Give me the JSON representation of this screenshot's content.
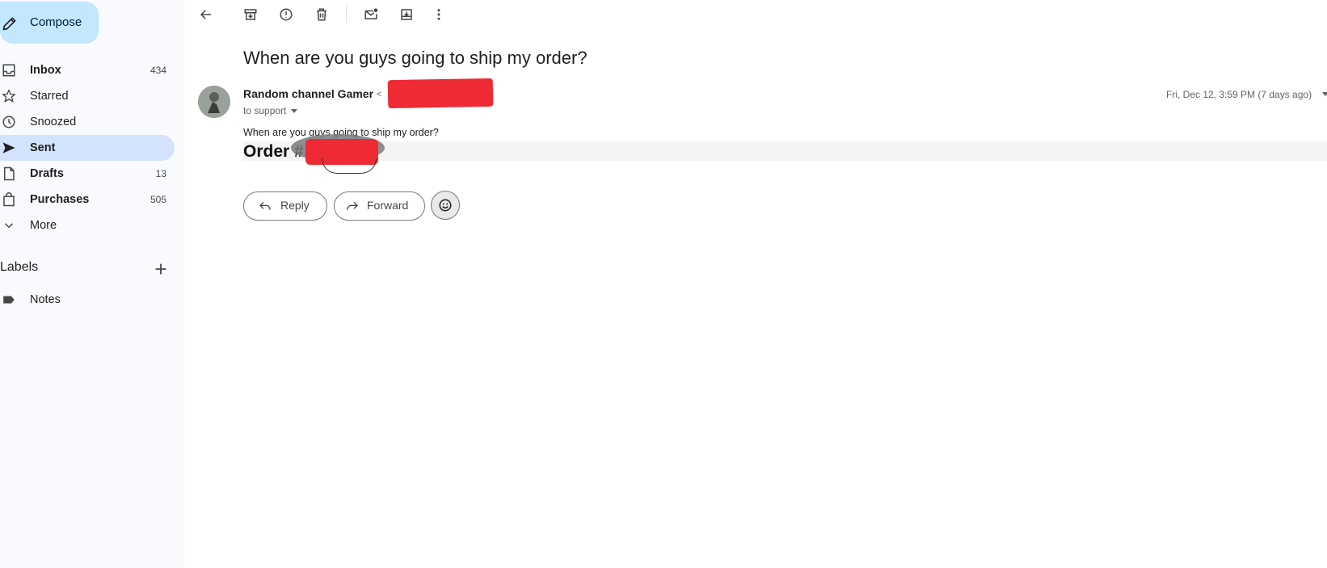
{
  "sidebar": {
    "compose_label": "Compose",
    "items": [
      {
        "label": "Inbox",
        "count": "434"
      },
      {
        "label": "Starred",
        "count": ""
      },
      {
        "label": "Snoozed",
        "count": ""
      },
      {
        "label": "Sent",
        "count": ""
      },
      {
        "label": "Drafts",
        "count": "13"
      },
      {
        "label": "Purchases",
        "count": "505"
      },
      {
        "label": "More",
        "count": ""
      }
    ],
    "labels_heading": "Labels",
    "labels": [
      {
        "label": "Notes"
      }
    ]
  },
  "toolbar": {
    "icons": [
      "back-arrow-icon",
      "archive-icon",
      "report-spam-icon",
      "delete-icon",
      "mark-unread-icon",
      "move-to-icon",
      "more-vert-icon"
    ]
  },
  "message": {
    "subject": "When are you guys going to ship my order?",
    "sender_name": "Random channel Gamer",
    "sender_email_prefix": "<",
    "recipient": "to support",
    "date": "Fri, Dec 12, 3:59 PM (7 days ago)",
    "body_line": "When are you guys going to ship my order?",
    "order_label": "Order #"
  },
  "actions": {
    "reply_label": "Reply",
    "forward_label": "Forward"
  },
  "colors": {
    "sidebar_bg": "#f8fafd",
    "compose_bg": "#c2e7ff",
    "active_nav_bg": "#d3e3fd",
    "redaction": "#ee2a35"
  }
}
